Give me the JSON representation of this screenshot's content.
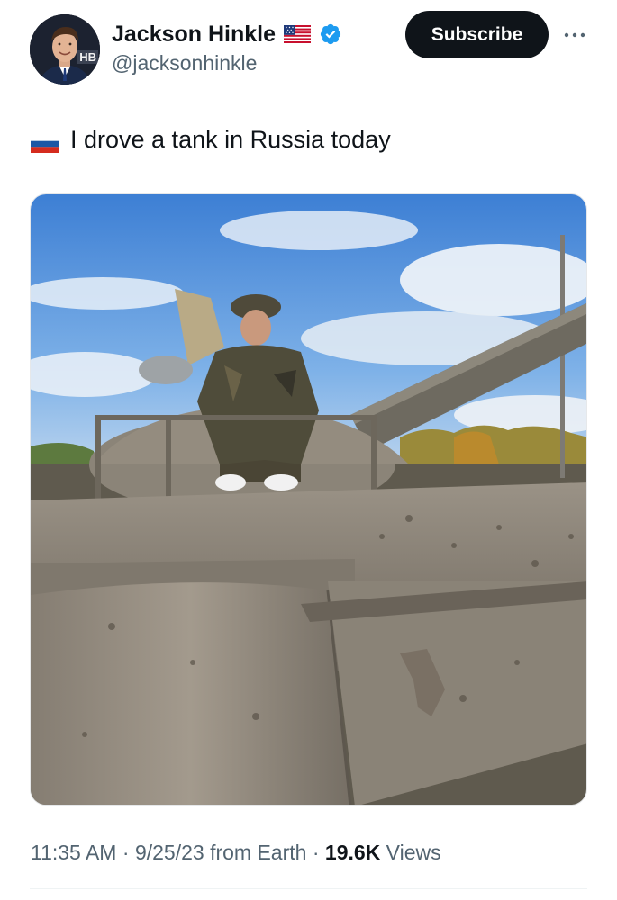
{
  "author": {
    "display_name": "Jackson Hinkle",
    "handle": "@jacksonhinkle",
    "avatar_badge": "HB"
  },
  "header": {
    "subscribe_label": "Subscribe",
    "more_label": "•••"
  },
  "tweet": {
    "text": "I drove a tank in Russia today",
    "flag_icon": "russia-flag-icon"
  },
  "meta": {
    "time": "11:35 AM",
    "separator": "·",
    "date": "9/25/23",
    "source": "from Earth",
    "views_count": "19.6K",
    "views_label": "Views"
  },
  "colors": {
    "text_primary": "#0f1419",
    "text_secondary": "#536471",
    "verified_blue": "#1d9bf0",
    "button_bg": "#0f1419",
    "divider": "#eff3f4"
  }
}
